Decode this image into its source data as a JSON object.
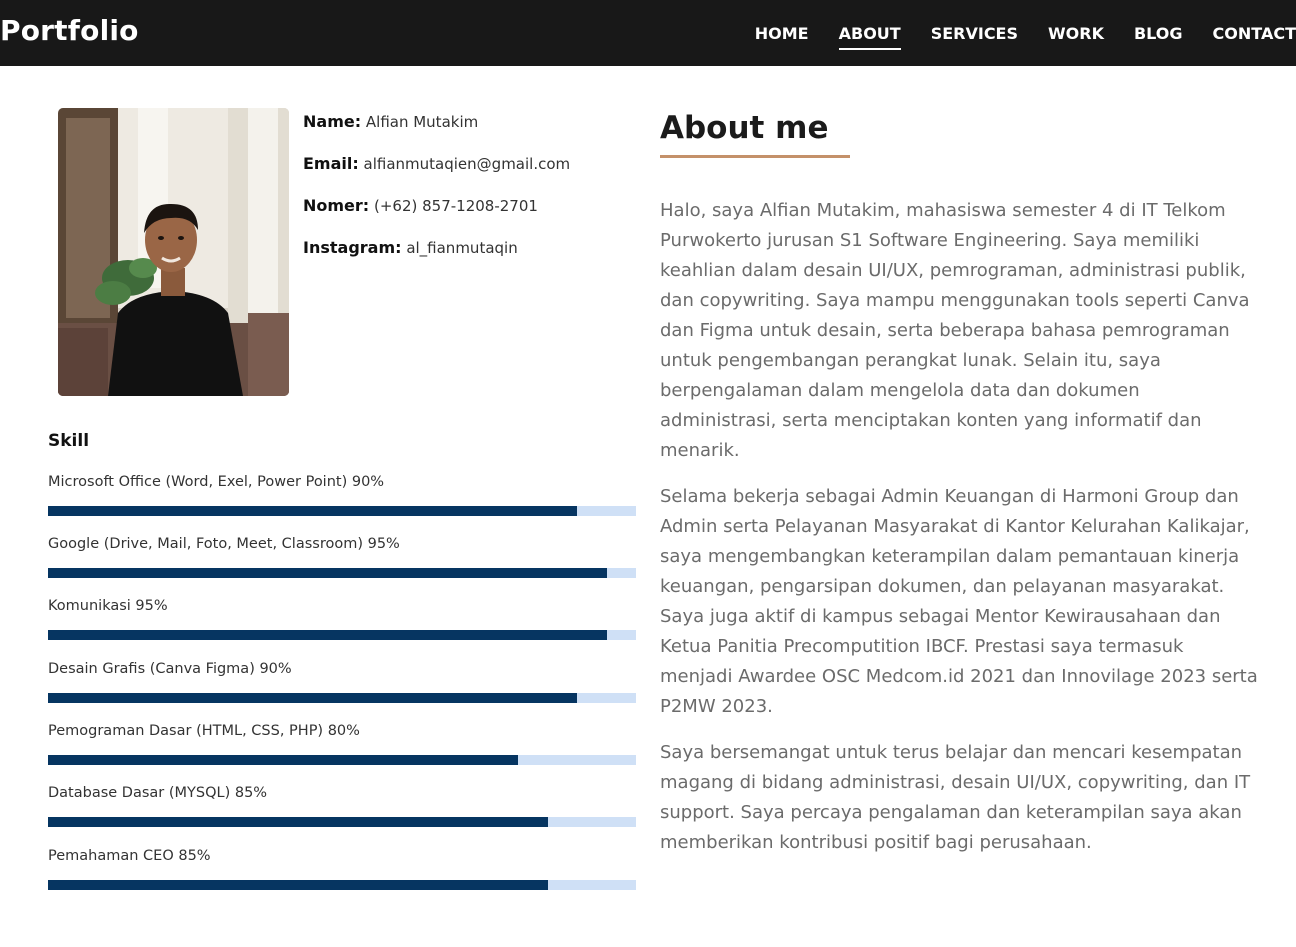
{
  "navbar": {
    "brand": "Portfolio",
    "links": [
      {
        "label": "HOME"
      },
      {
        "label": "ABOUT",
        "active": true
      },
      {
        "label": "SERVICES"
      },
      {
        "label": "WORK"
      },
      {
        "label": "BLOG"
      },
      {
        "label": "CONTACT"
      }
    ]
  },
  "profile": {
    "photo_alt": "profile-photo",
    "fields": [
      {
        "label": "Name:",
        "value": "Alfian Mutakim"
      },
      {
        "label": "Email:",
        "value": "alfianmutaqien@gmail.com"
      },
      {
        "label": "Nomer:",
        "value": "(+62) 857-1208-2701"
      },
      {
        "label": "Instagram:",
        "value": "al_fianmutaqin"
      }
    ]
  },
  "skills": {
    "title": "Skill",
    "items": [
      {
        "label": "Microsoft Office (Word, Exel, Power Point) 90%",
        "percent": 90
      },
      {
        "label": "Google (Drive, Mail, Foto, Meet, Classroom) 95%",
        "percent": 95
      },
      {
        "label": "Komunikasi 95%",
        "percent": 95
      },
      {
        "label": "Desain Grafis (Canva Figma) 90%",
        "percent": 90
      },
      {
        "label": "Pemograman Dasar (HTML, CSS, PHP) 80%",
        "percent": 80
      },
      {
        "label": "Database Dasar (MYSQL) 85%",
        "percent": 85
      },
      {
        "label": "Pemahaman CEO 85%",
        "percent": 85
      }
    ]
  },
  "about": {
    "title": "About me",
    "paragraphs": [
      "Halo, saya Alfian Mutakim, mahasiswa semester 4 di IT Telkom Purwokerto jurusan S1 Software Engineering. Saya memiliki keahlian dalam desain UI/UX, pemrograman, administrasi publik, dan copywriting. Saya mampu menggunakan tools seperti Canva dan Figma untuk desain, serta beberapa bahasa pemrograman untuk pengembangan perangkat lunak. Selain itu, saya berpengalaman dalam mengelola data dan dokumen administrasi, serta menciptakan konten yang informatif dan menarik.",
      "Selama bekerja sebagai Admin Keuangan di Harmoni Group dan Admin serta Pelayanan Masyarakat di Kantor Kelurahan Kalikajar, saya mengembangkan keterampilan dalam pemantauan kinerja keuangan, pengarsipan dokumen, dan pelayanan masyarakat. Saya juga aktif di kampus sebagai Mentor Kewirausahaan dan Ketua Panitia Precomputition IBCF. Prestasi saya termasuk menjadi Awardee OSC Medcom.id 2021 dan Innovilage 2023 serta P2MW 2023.",
      "Saya bersemangat untuk terus belajar dan mencari kesempatan magang di bidang administrasi, desain UI/UX, copywriting, dan IT support. Saya percaya pengalaman dan keterampilan saya akan memberikan kontribusi positif bagi perusahaan."
    ]
  },
  "colors": {
    "navbar_bg": "#181818",
    "skill_fill": "#063561",
    "skill_track": "#cfe0f6",
    "accent_underline": "#c4916a"
  }
}
